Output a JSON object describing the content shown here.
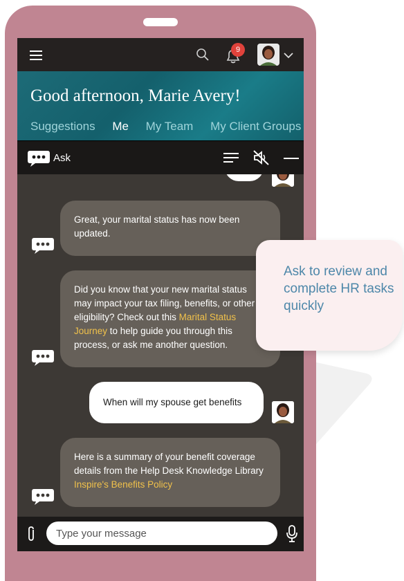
{
  "header": {
    "notification_count": "9",
    "greeting": "Good afternoon, Marie Avery!",
    "tabs": [
      {
        "label": "Suggestions",
        "active": false
      },
      {
        "label": "Me",
        "active": true
      },
      {
        "label": "My Team",
        "active": false
      },
      {
        "label": "My Client Groups",
        "active": false
      }
    ]
  },
  "assistant": {
    "title": "Ask",
    "messages": [
      {
        "from": "bot",
        "text_parts": [
          "Great, your marital status has now been updated."
        ]
      },
      {
        "from": "bot",
        "text": "Did you know that your new marital status may impact your tax filing, benefits, or other eligibility? Check out this ",
        "link": "Marital Status Journey",
        "after": " to help guide you through this process, or ask me another question."
      },
      {
        "from": "user",
        "text": "When will my spouse get benefits"
      },
      {
        "from": "bot",
        "text": "Here is a summary of your benefit coverage details from the Help Desk Knowledge Library ",
        "link": "Inspire's Benefits Policy"
      }
    ],
    "input_placeholder": "Type your message"
  },
  "callout": {
    "text": "Ask to review and complete HR tasks quickly"
  },
  "icons": {
    "menu": "hamburger-icon",
    "search": "search-icon",
    "notifications": "bell-icon",
    "profile": "avatar",
    "chat": "chat-bubble-icon",
    "list": "list-icon",
    "mute": "mute-icon",
    "minimize": "minimize-icon",
    "attach": "paperclip-icon",
    "mic": "microphone-icon"
  },
  "colors": {
    "frame": "#c08592",
    "banner": "#1a7c88",
    "link": "#f0c14b",
    "badge": "#e0423b",
    "callout_text": "#4d87a9"
  }
}
